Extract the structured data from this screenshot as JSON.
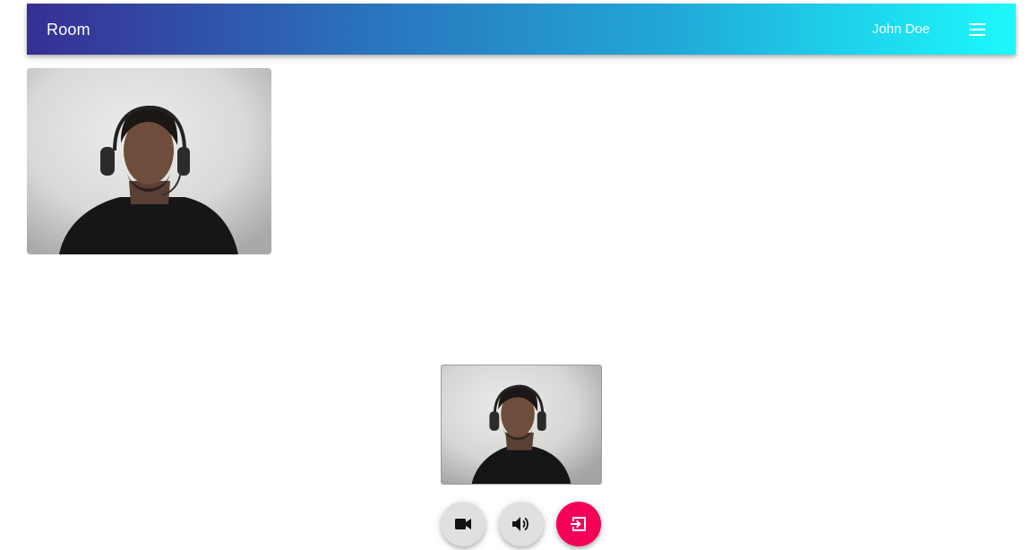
{
  "header": {
    "title": "Room",
    "user_name": "John Doe",
    "menu_icon": "menu-icon"
  },
  "videos": {
    "remote": {
      "kind": "remote-participant-video"
    },
    "local": {
      "kind": "local-preview-video"
    }
  },
  "controls": [
    {
      "name": "toggle-video-button",
      "icon": "videocam-icon"
    },
    {
      "name": "toggle-audio-button",
      "icon": "volume-up-icon"
    },
    {
      "name": "leave-room-button",
      "icon": "exit-icon"
    }
  ],
  "colors": {
    "appbar_gradient_start": "#372f93",
    "appbar_gradient_end": "#1cf9fc",
    "leave_button": "#f50057",
    "control_button": "#e0e0e0"
  }
}
